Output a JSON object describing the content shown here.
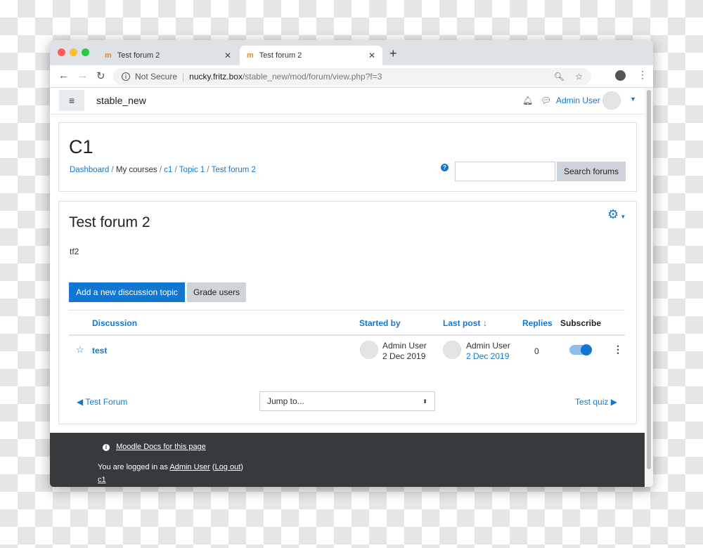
{
  "browser": {
    "tabs": [
      {
        "title": "Test forum 2"
      },
      {
        "title": "Test forum 2"
      }
    ],
    "security": "Not Secure",
    "url_host": "nucky.fritz.box",
    "url_path": "/stable_new/mod/forum/view.php?f=3"
  },
  "navbar": {
    "site_name": "stable_new",
    "user_name": "Admin User"
  },
  "header": {
    "course_title": "C1",
    "breadcrumb": [
      "Dashboard",
      "My courses",
      "c1",
      "Topic 1",
      "Test forum 2"
    ],
    "search_placeholder": "",
    "search_button": "Search forums"
  },
  "forum": {
    "title": "Test forum 2",
    "description": "tf2",
    "add_button": "Add a new discussion topic",
    "grade_button": "Grade users",
    "columns": {
      "discussion": "Discussion",
      "started_by": "Started by",
      "last_post": "Last post",
      "replies": "Replies",
      "subscribe": "Subscribe"
    },
    "rows": [
      {
        "topic": "test",
        "starter": "Admin User",
        "started": "2 Dec 2019",
        "last_user": "Admin User",
        "last_date": "2 Dec 2019",
        "replies": "0",
        "subscribed": true
      }
    ],
    "prev_link": "Test Forum",
    "jump_to": "Jump to...",
    "next_link": "Test quiz"
  },
  "footer": {
    "docs_link": "Moodle Docs for this page",
    "logged_in_prefix": "You are logged in as",
    "user": "Admin User",
    "logout": "Log out",
    "course": "c1"
  },
  "colors": {
    "accent": "#1177d1",
    "footer_bg": "#373a3c"
  }
}
